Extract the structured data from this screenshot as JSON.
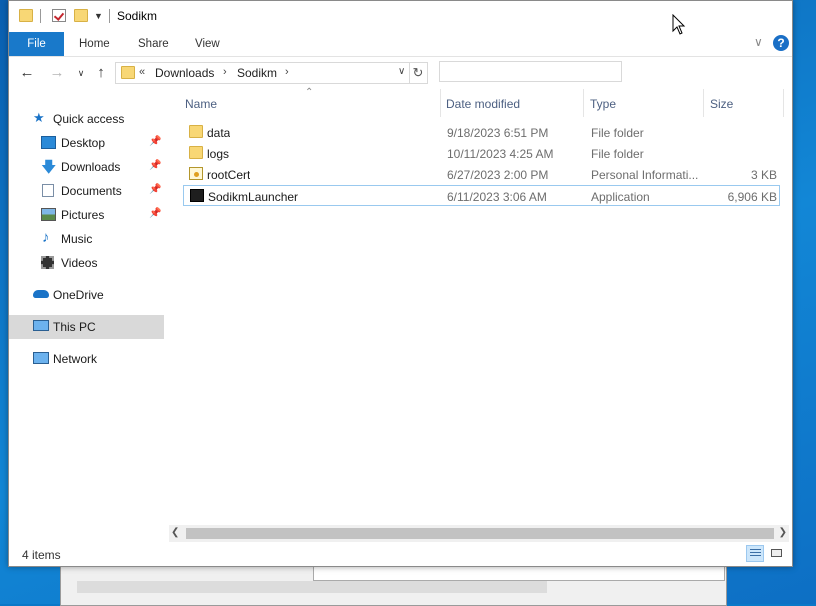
{
  "window": {
    "title": "Sodikm"
  },
  "ribbon": {
    "tabs": [
      "File",
      "Home",
      "Share",
      "View"
    ],
    "help_icon": "?"
  },
  "address": {
    "overflow": "«",
    "segments": [
      "Downloads",
      "Sodikm"
    ],
    "search_placeholder": ""
  },
  "nav": {
    "items": [
      {
        "label": "Quick access",
        "icon": "star-icon"
      },
      {
        "label": "Desktop",
        "icon": "desktop-icon",
        "pinned": true
      },
      {
        "label": "Downloads",
        "icon": "download-icon",
        "pinned": true
      },
      {
        "label": "Documents",
        "icon": "documents-icon",
        "pinned": true
      },
      {
        "label": "Pictures",
        "icon": "pictures-icon",
        "pinned": true
      },
      {
        "label": "Music",
        "icon": "music-icon"
      },
      {
        "label": "Videos",
        "icon": "videos-icon"
      },
      {
        "label": "OneDrive",
        "icon": "onedrive-icon"
      },
      {
        "label": "This PC",
        "icon": "this-pc-icon",
        "selected": true
      },
      {
        "label": "Network",
        "icon": "network-icon"
      }
    ]
  },
  "columns": {
    "name": "Name",
    "date": "Date modified",
    "type": "Type",
    "size": "Size"
  },
  "files": [
    {
      "name": "data",
      "date": "9/18/2023 6:51 PM",
      "type": "File folder",
      "size": "",
      "icon": "folder-icon"
    },
    {
      "name": "logs",
      "date": "10/11/2023 4:25 AM",
      "type": "File folder",
      "size": "",
      "icon": "folder-icon"
    },
    {
      "name": "rootCert",
      "date": "6/27/2023 2:00 PM",
      "type": "Personal Informati...",
      "size": "3 KB",
      "icon": "certificate-icon"
    },
    {
      "name": "SodikmLauncher",
      "date": "6/11/2023 3:06 AM",
      "type": "Application",
      "size": "6,906 KB",
      "icon": "application-icon"
    }
  ],
  "status": {
    "count": "4 items"
  },
  "colors": {
    "accent": "#1979ca",
    "selected_nav": "#d9d9d9",
    "focus_border": "#99c9ef"
  }
}
